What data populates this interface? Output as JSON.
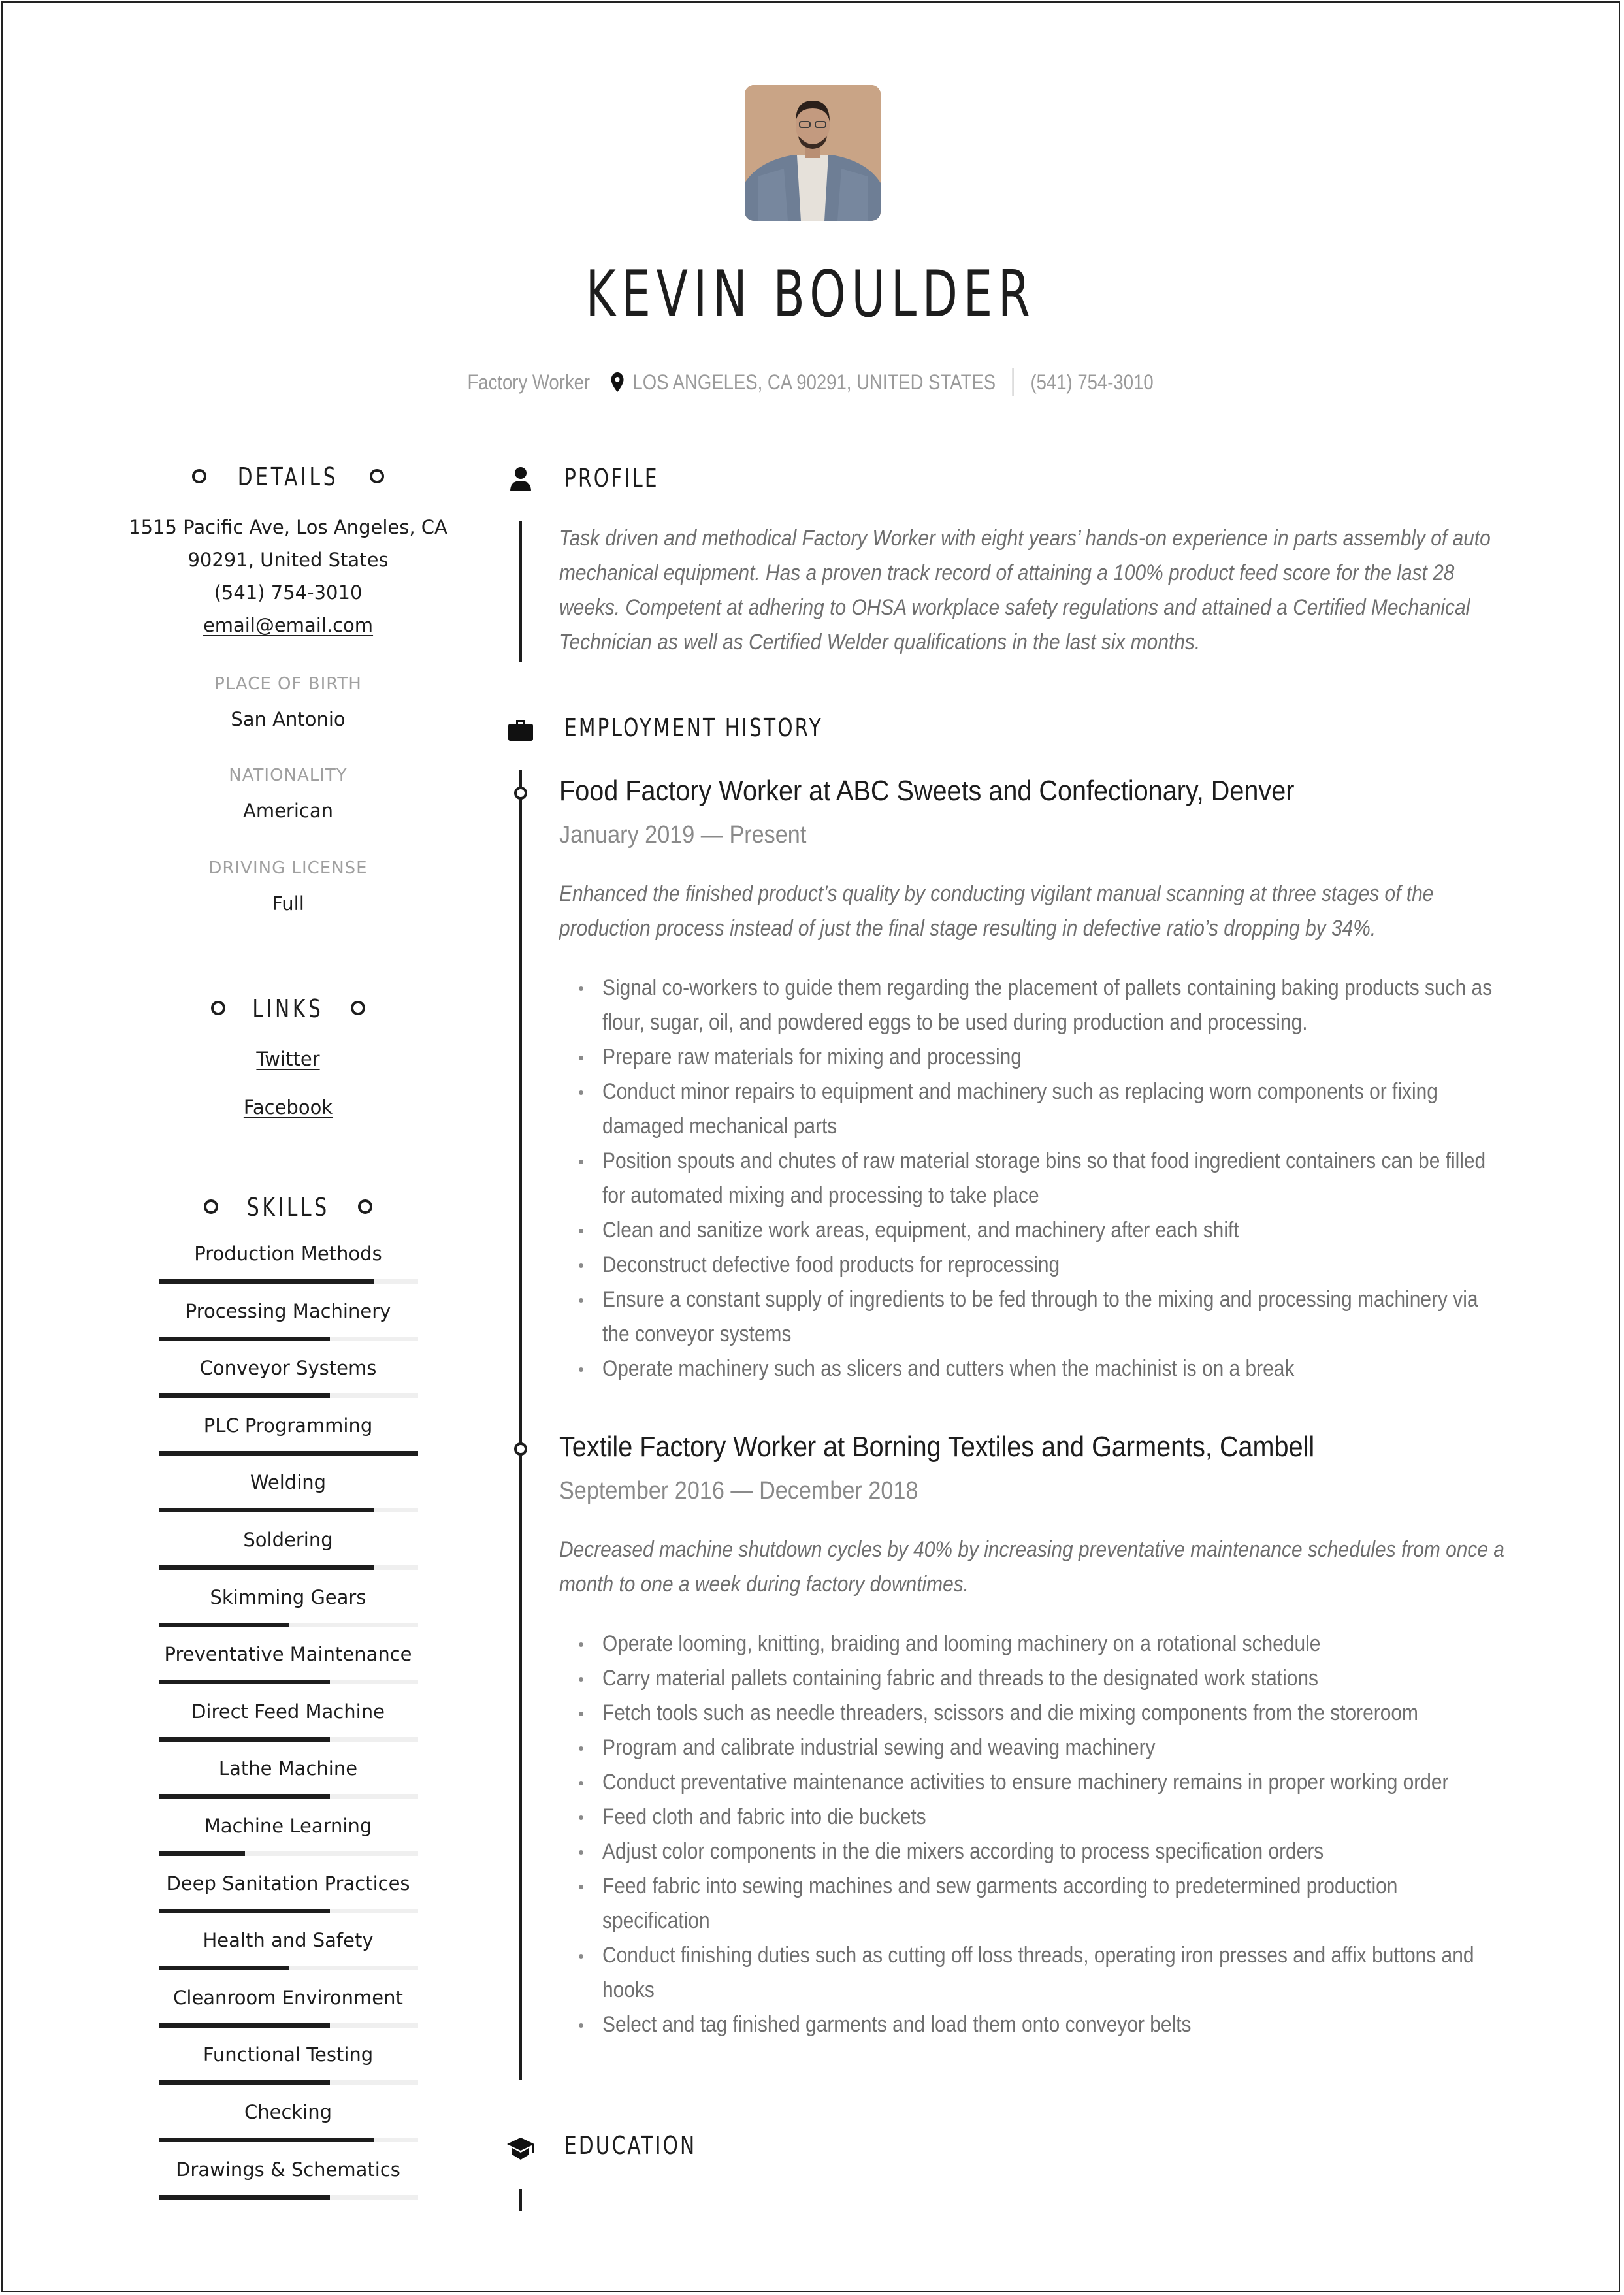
{
  "header": {
    "name": "KEVIN BOULDER",
    "job_title": "Factory Worker",
    "location": "LOS ANGELES, CA 90291, UNITED STATES",
    "phone": "(541) 754-3010",
    "photo_alt": "Profile photo"
  },
  "details": {
    "heading": "DETAILS",
    "address_line1": "1515 Pacific Ave, Los Angeles, CA",
    "address_line2": "90291, United States",
    "phone": "(541) 754-3010",
    "email": "email@email.com",
    "place_of_birth_label": "PLACE OF BIRTH",
    "place_of_birth": "San Antonio",
    "nationality_label": "NATIONALITY",
    "nationality": "American",
    "driving_license_label": "DRIVING LICENSE",
    "driving_license": "Full"
  },
  "links": {
    "heading": "LINKS",
    "items": [
      {
        "label": "Twitter"
      },
      {
        "label": "Facebook"
      }
    ]
  },
  "skills": {
    "heading": "SKILLS",
    "items": [
      {
        "name": "Production Methods",
        "level": 0.83
      },
      {
        "name": "Processing Machinery",
        "level": 0.66
      },
      {
        "name": "Conveyor Systems",
        "level": 0.66
      },
      {
        "name": "PLC Programming",
        "level": 1.0
      },
      {
        "name": "Welding",
        "level": 0.83
      },
      {
        "name": "Soldering",
        "level": 0.83
      },
      {
        "name": "Skimming Gears",
        "level": 0.5
      },
      {
        "name": "Preventative Maintenance",
        "level": 0.66
      },
      {
        "name": "Direct Feed Machine",
        "level": 0.66
      },
      {
        "name": "Lathe Machine",
        "level": 0.66
      },
      {
        "name": "Machine Learning",
        "level": 0.33
      },
      {
        "name": "Deep Sanitation Practices",
        "level": 0.66
      },
      {
        "name": "Health and Safety",
        "level": 0.5
      },
      {
        "name": "Cleanroom Environment",
        "level": 0.66
      },
      {
        "name": "Functional Testing",
        "level": 0.66
      },
      {
        "name": "Checking",
        "level": 0.83
      },
      {
        "name": "Drawings & Schematics",
        "level": 0.66
      }
    ]
  },
  "profile": {
    "heading": "PROFILE",
    "text": "Task driven and methodical Factory Worker with eight years’ hands-on experience in parts assembly of auto mechanical equipment. Has a proven track record of attaining a 100% product feed score for the last 28 weeks. Competent at adhering to OHSA workplace safety regulations and attained a Certified Mechanical Technician as well as Certified Welder qualifications in the last six months."
  },
  "employment": {
    "heading": "EMPLOYMENT HISTORY",
    "jobs": [
      {
        "title": "Food Factory Worker at  ABC Sweets and Confectionary, Denver",
        "dates": "January 2019 — Present",
        "summary": "Enhanced the finished product’s quality by conducting vigilant manual scanning at three stages of the production process instead of just the final stage resulting in defective ratio’s dropping by 34%.",
        "bullets": [
          "Signal co-workers to guide them regarding the placement of pallets containing baking products such as flour, sugar, oil, and powdered eggs to be used during production and processing.",
          "Prepare raw materials for mixing and processing",
          "Conduct minor repairs to equipment and machinery such as replacing worn components or fixing damaged mechanical parts",
          "Position spouts and chutes of raw material storage bins so that food ingredient containers can be filled for automated mixing and processing to take place",
          "Clean and sanitize work areas, equipment, and machinery after each shift",
          "Deconstruct defective food products for reprocessing",
          "Ensure a constant supply of ingredients to be fed through to the mixing and processing machinery via the conveyor systems",
          "Operate machinery such as slicers and cutters when the machinist is on a break"
        ]
      },
      {
        "title": "Textile Factory Worker at  Borning Textiles and Garments, Cambell",
        "dates": "September 2016 — December 2018",
        "summary": "Decreased machine shutdown cycles by 40% by increasing preventative maintenance schedules from once a month to one a week during factory downtimes.",
        "bullets": [
          "Operate looming, knitting, braiding and looming machinery on a rotational schedule",
          "Carry material pallets containing fabric and threads to the designated work stations",
          "Fetch tools such as needle threaders, scissors and die mixing components from the storeroom",
          "Program and calibrate industrial sewing and weaving machinery",
          "Conduct preventative maintenance activities to ensure machinery remains in proper working order",
          "Feed cloth and fabric into die buckets",
          "Adjust color components in the die mixers according to process specification orders",
          "Feed fabric into sewing machines and sew garments according to predetermined production specification",
          "Conduct finishing duties such as cutting off loss threads, operating iron presses and affix buttons and hooks",
          "Select and tag finished garments and load them onto conveyor belts"
        ]
      }
    ]
  },
  "education": {
    "heading": "EDUCATION"
  },
  "icons": {
    "profile": "person-icon",
    "employment": "briefcase-icon",
    "education": "graduation-cap-icon",
    "location": "map-pin-icon"
  },
  "colors": {
    "text_dark": "#1d1d1d",
    "text_muted": "#6f6f6f",
    "text_light": "#9a9a9a",
    "bar_track": "#efefef",
    "photo_bg": "#c7a282"
  }
}
